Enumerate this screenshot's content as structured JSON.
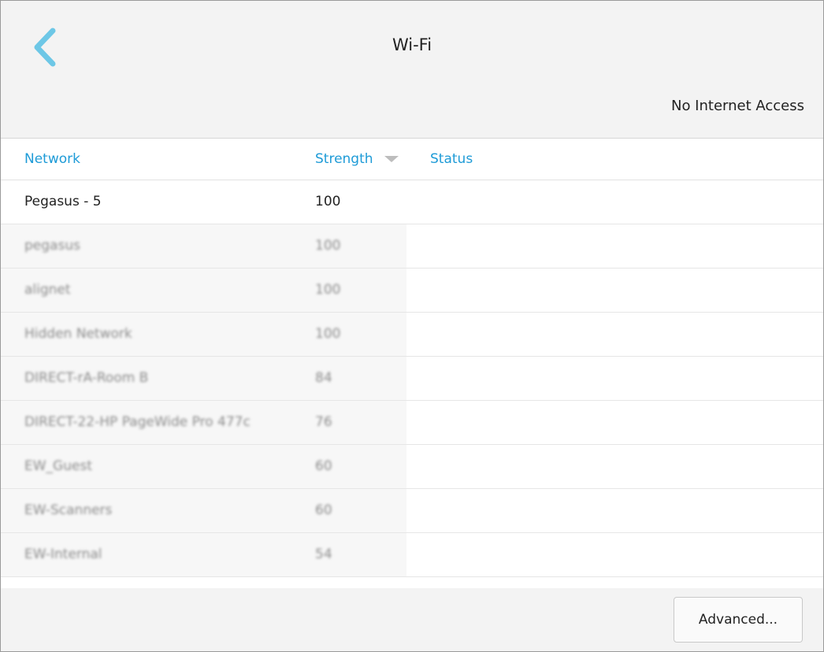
{
  "header": {
    "title": "Wi-Fi",
    "connection_status": "No Internet Access",
    "back_icon": "chevron-left-icon",
    "accent_color": "#6dc7e6"
  },
  "table": {
    "columns": {
      "network": "Network",
      "strength": "Strength",
      "status": "Status"
    },
    "sorted_by": "Strength",
    "sort_direction": "descending",
    "header_color": "#1e9bd7",
    "rows": [
      {
        "network": "Pegasus - 5",
        "strength": "100",
        "status": "",
        "blurred": false
      },
      {
        "network": "pegasus",
        "strength": "100",
        "status": "",
        "blurred": true
      },
      {
        "network": "alignet",
        "strength": "100",
        "status": "",
        "blurred": true
      },
      {
        "network": "Hidden Network",
        "strength": "100",
        "status": "",
        "blurred": true
      },
      {
        "network": "DIRECT-rA-Room B",
        "strength": "84",
        "status": "",
        "blurred": true
      },
      {
        "network": "DIRECT-22-HP PageWide Pro 477c",
        "strength": "76",
        "status": "",
        "blurred": true
      },
      {
        "network": "EW_Guest",
        "strength": "60",
        "status": "",
        "blurred": true
      },
      {
        "network": "EW-Scanners",
        "strength": "60",
        "status": "",
        "blurred": true
      },
      {
        "network": "EW-Internal",
        "strength": "54",
        "status": "",
        "blurred": true
      }
    ]
  },
  "footer": {
    "advanced_label": "Advanced..."
  }
}
